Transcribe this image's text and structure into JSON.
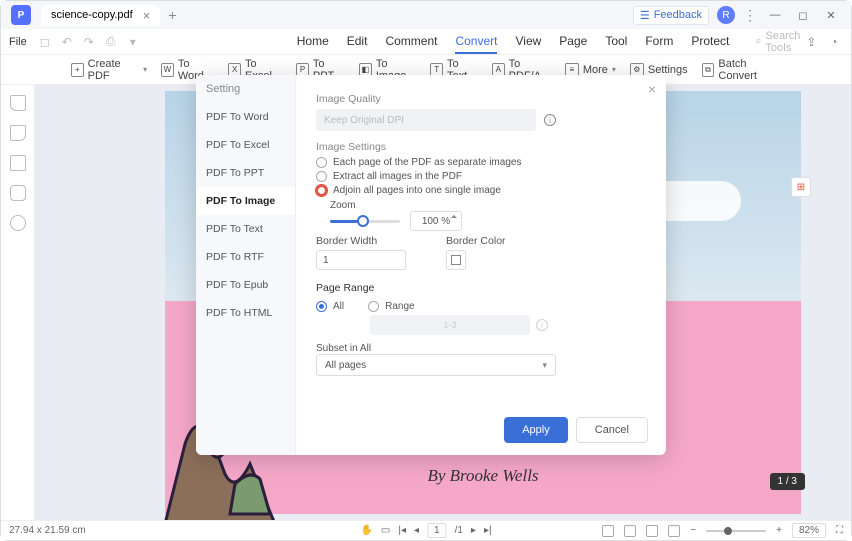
{
  "titlebar": {
    "tab_name": "science-copy.pdf",
    "feedback": "Feedback"
  },
  "menubar": {
    "file": "File",
    "tabs": [
      "Home",
      "Edit",
      "Comment",
      "Convert",
      "View",
      "Page",
      "Tool",
      "Form",
      "Protect"
    ],
    "active_tab": "Convert",
    "search_placeholder": "Search Tools"
  },
  "toolbar": {
    "create": "Create PDF",
    "to_word": "To Word",
    "to_excel": "To Excel",
    "to_ppt": "To PPT",
    "to_image": "To Image",
    "to_text": "To Text",
    "to_pdfa": "To PDF/A",
    "more": "More",
    "settings": "Settings",
    "batch": "Batch Convert"
  },
  "document": {
    "byline": "By Brooke Wells"
  },
  "dialog": {
    "title": "Setting",
    "side_items": [
      "PDF To Word",
      "PDF To Excel",
      "PDF To PPT",
      "PDF To Image",
      "PDF To Text",
      "PDF To RTF",
      "PDF To Epub",
      "PDF To HTML"
    ],
    "active_side": "PDF To Image",
    "image_quality_lbl": "Image Quality",
    "dpi_text": "Keep Original DPI",
    "image_settings_lbl": "Image Settings",
    "opt1": "Each page of the PDF as separate images",
    "opt2": "Extract all images in the PDF",
    "opt3": "Adjoin all pages into one single image",
    "zoom_lbl": "Zoom",
    "zoom_val": "100 %",
    "border_width_lbl": "Border Width",
    "border_width_val": "1",
    "border_color_lbl": "Border Color",
    "page_range_lbl": "Page Range",
    "pr_all": "All",
    "pr_range": "Range",
    "range_hint": "1-3",
    "subset_lbl": "Subset in All",
    "subset_val": "All pages",
    "apply": "Apply",
    "cancel": "Cancel"
  },
  "statusbar": {
    "dims": "27.94 x 21.59 cm",
    "page_cur": "1",
    "page_sep": "/1",
    "zoom": "82%",
    "page_badge": "1 / 3"
  }
}
